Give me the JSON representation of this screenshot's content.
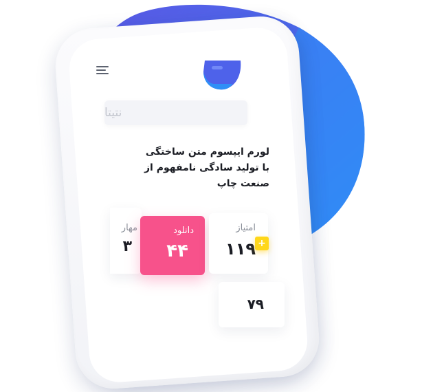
{
  "app": {
    "search": {
      "placeholder": "نتیتا"
    },
    "headline": [
      "لورم ایپسوم متن ساختگی",
      "با تولید سادگی نامفهوم از",
      "صنعت چاپ"
    ],
    "stats": [
      {
        "label": "مهار",
        "value": "۳"
      },
      {
        "label": "دانلود",
        "value": "۴۴"
      },
      {
        "label": "امتیاز",
        "value": "۱۱۹"
      },
      {
        "label": "",
        "value": "۷۹"
      }
    ],
    "plus_badge": "+",
    "icons": {
      "menu": "hamburger-menu-icon",
      "logo": "app-logo-icon"
    },
    "colors": {
      "accent_blue": "#3d84f5",
      "accent_purple": "#5b5ce6",
      "download_pink": "#f7528b",
      "badge_yellow": "#ffd71a"
    }
  }
}
